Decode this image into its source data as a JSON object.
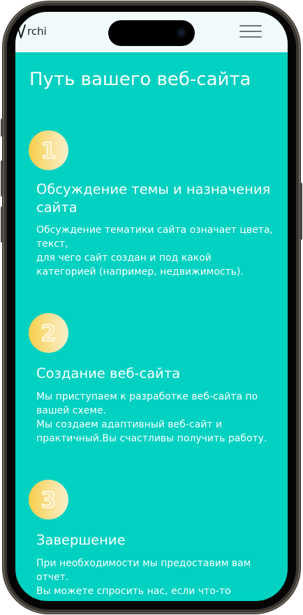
{
  "header": {
    "logo_text": "rchi",
    "menu_icon": "hamburger-menu-icon"
  },
  "page": {
    "title": "Путь вашего веб-сайта"
  },
  "steps": [
    {
      "number": "1",
      "title": "Обсуждение темы и назначения сайта",
      "text": "Обсуждение тематики сайта означает цвета, текст,\nдля чего сайт создан и под какой категорией (например, недвижимость)."
    },
    {
      "number": "2",
      "title": "Создание веб-сайта",
      "text": "Мы приступаем к разработке веб-сайта по вашей схеме.\nМы создаем адаптивный веб-сайт и практичный.Вы счастливы получить работу."
    },
    {
      "number": "3",
      "title": "Завершение",
      "text": "При необходимости мы предоставим вам отчет.\nВы можете спросить нас, если что-то"
    }
  ],
  "colors": {
    "accent": "#00d1c1",
    "header_bg": "#f2fbfb",
    "badge_gold": "#f7cf4a",
    "text": "#ffffff"
  }
}
